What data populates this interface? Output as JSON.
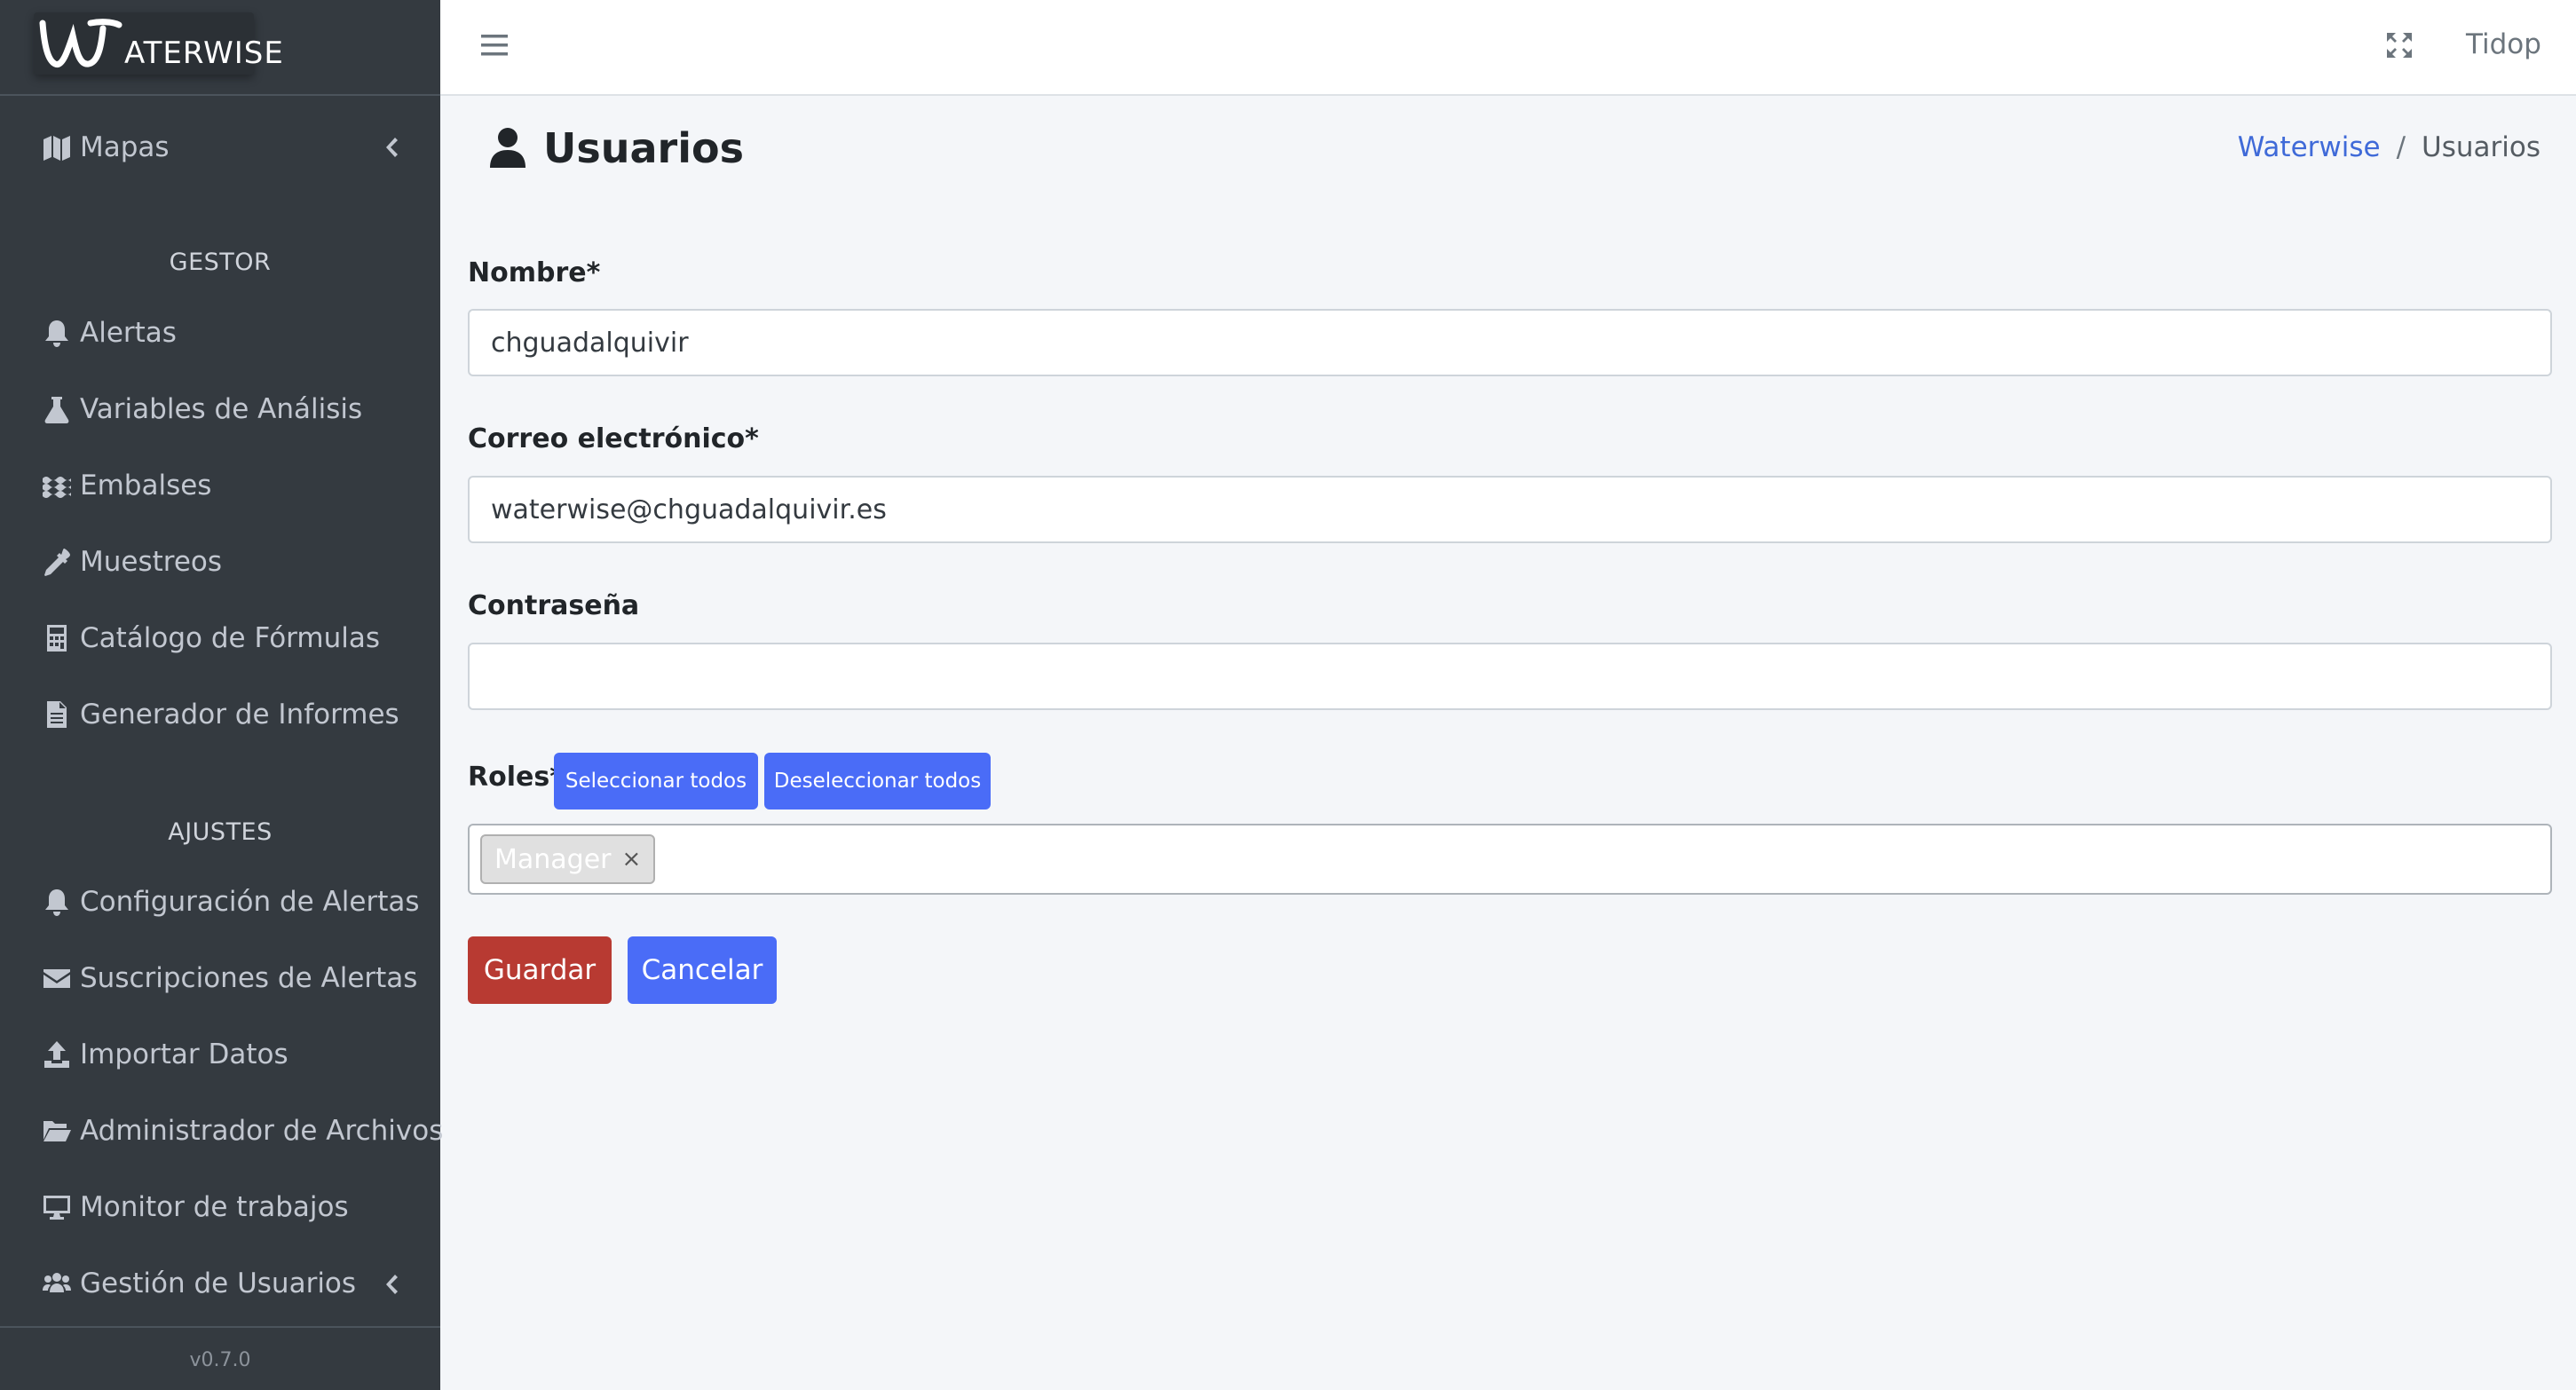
{
  "brand": {
    "logo_text": "ATERWISE"
  },
  "sidebar": {
    "maps": "Mapas",
    "section_gestor": "GESTOR",
    "gestor_items": [
      {
        "label": "Alertas"
      },
      {
        "label": "Variables de Análisis"
      },
      {
        "label": "Embalses"
      },
      {
        "label": "Muestreos"
      },
      {
        "label": "Catálogo de Fórmulas"
      },
      {
        "label": "Generador de Informes"
      }
    ],
    "section_ajustes": "AJUSTES",
    "ajustes_items": [
      {
        "label": "Configuración de Alertas"
      },
      {
        "label": "Suscripciones de Alertas"
      },
      {
        "label": "Importar Datos"
      },
      {
        "label": "Administrador de Archivos"
      },
      {
        "label": "Monitor de trabajos"
      },
      {
        "label": "Gestión de Usuarios"
      }
    ],
    "version": "v0.7.0"
  },
  "navbar": {
    "user": "Tidop"
  },
  "header": {
    "title": "Usuarios",
    "breadcrumb": {
      "root": "Waterwise",
      "separator": "/",
      "current": "Usuarios"
    }
  },
  "form": {
    "name_label": "Nombre*",
    "name_value": "chguadalquivir",
    "email_label": "Correo electrónico*",
    "email_value": "waterwise@chguadalquivir.es",
    "password_label": "Contraseña",
    "password_value": "",
    "roles_label": "Roles*",
    "select_all": "Seleccionar todos",
    "deselect_all": "Deseleccionar todos",
    "selected_role": "Manager",
    "remove_symbol": "×",
    "save": "Guardar",
    "cancel": "Cancelar"
  },
  "colors": {
    "sidebar_bg": "#343a40",
    "primary": "#4a6cf7",
    "danger": "#b83a32",
    "link": "#3f6ad8"
  }
}
